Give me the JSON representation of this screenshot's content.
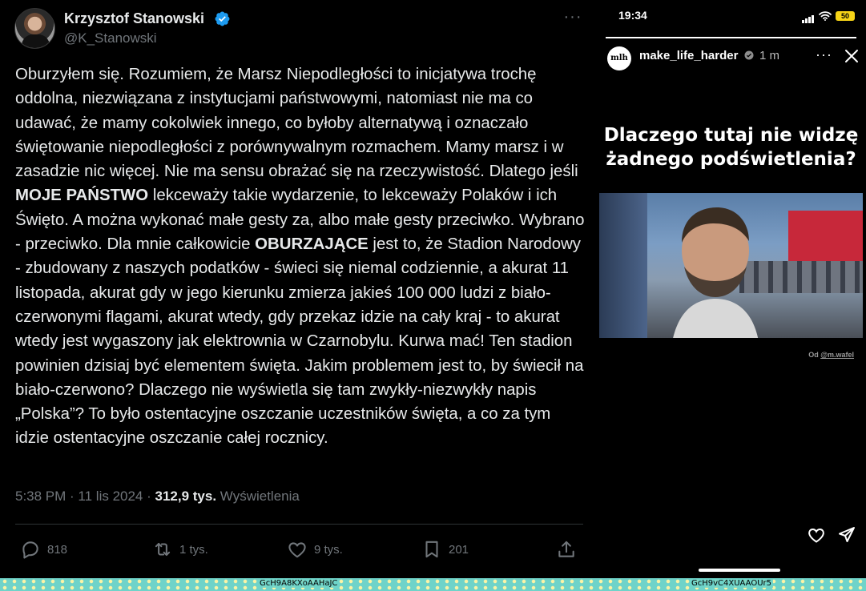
{
  "tweet": {
    "author_name": "Krzysztof Stanowski",
    "author_handle": "@K_Stanowski",
    "more_icon": "more-horizontal-icon",
    "text_before_bold1": "Oburzyłem się. Rozumiem, że Marsz Niepodległości to inicjatywa trochę oddolna, niezwiązana z instytucjami państwowymi, natomiast nie ma co udawać, że mamy cokolwiek innego, co byłoby alternatywą i oznaczało świętowanie niepodległości z porównywalnym rozmachem. Mamy marsz i w zasadzie nic więcej. Nie ma sensu obrażać się na rzeczywistość. Dlatego jeśli ",
    "bold1": "MOJE PAŃSTWO",
    "text_between": " lekceważy takie wydarzenie, to lekceważy Polaków i ich Święto. A można wykonać małe gesty za, albo małe gesty przeciwko. Wybrano - przeciwko. Dla mnie całkowicie ",
    "bold2": "OBURZAJĄCE",
    "text_after": " jest to, że Stadion Narodowy - zbudowany z naszych podatków - świeci się niemal codziennie, a akurat 11 listopada, akurat gdy w jego kierunku zmierza jakieś 100 000 ludzi z biało-czerwonymi flagami, akurat wtedy, gdy przekaz idzie na cały kraj - to akurat wtedy jest wygaszony jak elektrownia w Czarnobylu. Kurwa mać! Ten stadion powinien dzisiaj być elementem święta. Jakim problemem jest to, by świecił na biało-czerwono? Dlaczego nie wyświetla się tam zwykły-niezwykły napis „Polska”? To było ostentacyjne oszczanie uczestników święta, a co za tym idzie ostentacyjne oszczanie całej rocznicy.",
    "time": "5:38 PM",
    "date": "11 lis 2024",
    "views_count": "312,9 tys.",
    "views_label": "Wyświetlenia",
    "actions": {
      "replies": "818",
      "reposts": "1 tys.",
      "likes": "9 tys.",
      "bookmarks": "201"
    },
    "colors": {
      "verified": "#1d9bf0",
      "muted": "#71767b"
    }
  },
  "story": {
    "status_time": "19:34",
    "battery": "50",
    "avatar_text": "mlh",
    "username": "make_life_harder",
    "time_ago": "1 m",
    "headline_line1": "Dlaczego tutaj nie widzę",
    "headline_line2": "żadnego podświetlenia?",
    "credit_prefix": "Od",
    "credit_user": "@m.wafel",
    "progress": 1.0
  },
  "strip": {
    "left_id": "GcH9A8KXoAAHaJC",
    "right_id": "GcH9vC4XUAAOUr5"
  }
}
